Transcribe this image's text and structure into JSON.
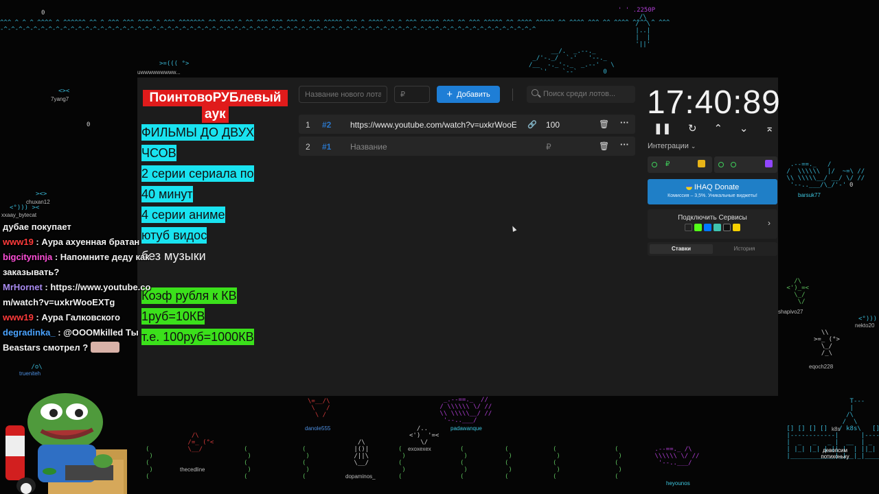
{
  "notes": {
    "title_line1": "ПоинтовоРУБлевый",
    "title_line2": "аук",
    "lines": [
      {
        "text": "ФИЛЬМЫ ДО ДВУХ",
        "style": "cyan"
      },
      {
        "text": "ЧСОВ",
        "style": "cyan"
      },
      {
        "text": "2 серии сериала по",
        "style": "cyan"
      },
      {
        "text": "40 минут",
        "style": "cyan"
      },
      {
        "text": "4 серии аниме",
        "style": "cyan"
      },
      {
        "text": "ютуб видос",
        "style": "cyan"
      },
      {
        "text": "без музыки",
        "style": "plain"
      },
      {
        "text": "",
        "style": "plain"
      },
      {
        "text": "Коэф рубля к КВ",
        "style": "green"
      },
      {
        "text": "1руб=10КВ",
        "style": "green"
      },
      {
        "text": "т.е. 100руб=1000КВ",
        "style": "green"
      }
    ]
  },
  "toolbar": {
    "new_lot_placeholder": "Название нового лота",
    "amount_placeholder": "₽",
    "add_label": "Добавить",
    "search_placeholder": "Поиск среди лотов..."
  },
  "lots": [
    {
      "index": "1",
      "id": "#2",
      "name": "https://www.youtube.com/watch?v=uxkrWooEXTg",
      "amount": "100"
    },
    {
      "index": "2",
      "id": "#1",
      "name": "Название",
      "amount": "₽"
    }
  ],
  "timer": {
    "value": "17:40:89"
  },
  "sidebar": {
    "integrations_label": "Интеграции",
    "donate_title": "IHAQ Donate",
    "donate_sub": "Комиссия – 3,5%. Уникальные виджеты!",
    "connect_label": "Подключить Сервисы",
    "tab_bets": "Ставки",
    "tab_history": "История",
    "service_rub": "₽"
  },
  "chat": [
    {
      "user": "",
      "msg": "дубае покупает",
      "color": "#ffffff"
    },
    {
      "user": "www19",
      "msg": "Аура ахуенная братан",
      "color": "#ff3b3b"
    },
    {
      "user": "bigcityninja",
      "msg": "Напомните деду как заказывать?",
      "color": "#ff4fd8"
    },
    {
      "user": "MrHornet",
      "msg": "https://www.youtube.com/watch?v=uxkrWooEXTg",
      "color": "#a98bf0"
    },
    {
      "user": "www19",
      "msg": "Аура Галковского",
      "color": "#ff3b3b"
    },
    {
      "user": "degradinka_",
      "msg": "@OOOMkilled Ты Beastars смотрел ?",
      "color": "#4aa3ff"
    }
  ],
  "background": {
    "top_number": "2250P",
    "names": [
      "7yang7",
      "chuxan12",
      "xxaay_bytecat",
      "barsuk77",
      "shapivo27",
      "nekto20",
      "eqoch228",
      "danole555",
      "padawanque",
      "exoxexex",
      "dopaminos_",
      "thecedline",
      "heyounos",
      "k8s",
      "trueniteh",
      "uwwwwwwwww..."
    ],
    "castle_text": "девопсим потихоньку"
  }
}
